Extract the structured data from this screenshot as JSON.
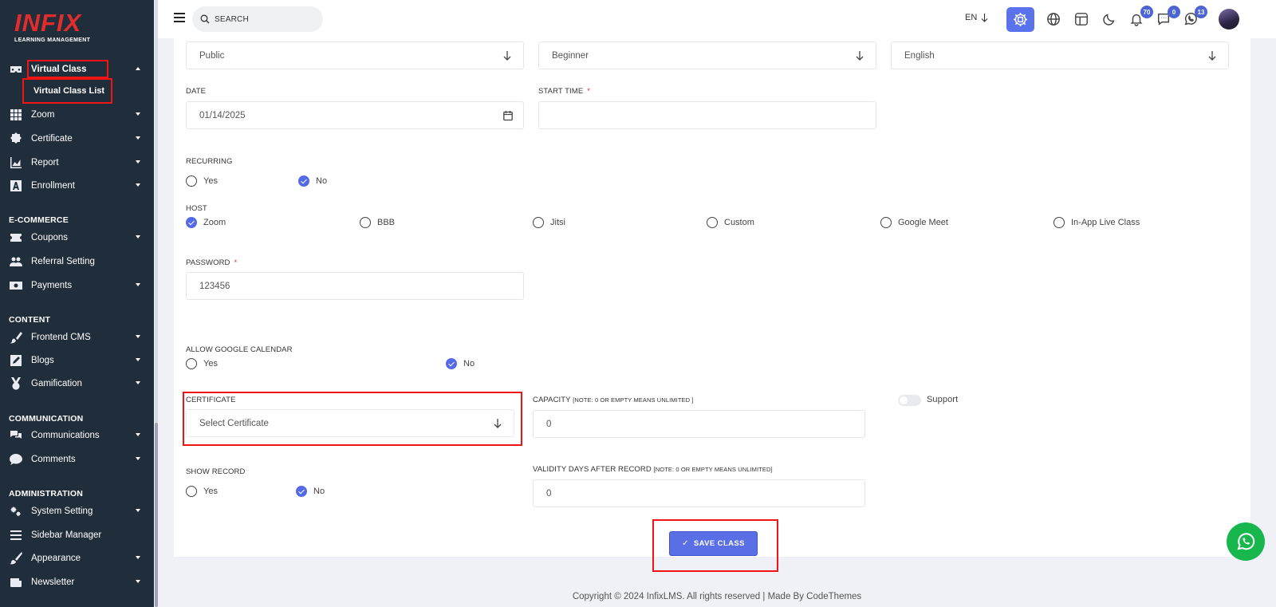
{
  "app": {
    "logo_text": "INFIX",
    "logo_subtitle": "LEARNING MANAGEMENT"
  },
  "sidebar": {
    "active_parent": "Virtual Class",
    "active_sub": "Virtual Class List",
    "items": [
      {
        "label": "Zoom",
        "icon": "grid-icon"
      },
      {
        "label": "Certificate",
        "icon": "badge-icon"
      },
      {
        "label": "Report",
        "icon": "chart-icon"
      },
      {
        "label": "Enrollment",
        "icon": "enrollment-icon"
      },
      {
        "label": "Coupons",
        "icon": "ticket-icon"
      },
      {
        "label": "Referral Setting",
        "icon": "users-icon"
      },
      {
        "label": "Payments",
        "icon": "money-icon"
      },
      {
        "label": "Frontend CMS",
        "icon": "brush-icon"
      },
      {
        "label": "Blogs",
        "icon": "pen-icon"
      },
      {
        "label": "Gamification",
        "icon": "medal-icon"
      },
      {
        "label": "Communications",
        "icon": "chat-icon"
      },
      {
        "label": "Comments",
        "icon": "comment-icon"
      },
      {
        "label": "System Setting",
        "icon": "gears-icon"
      },
      {
        "label": "Sidebar Manager",
        "icon": "list-icon"
      },
      {
        "label": "Appearance",
        "icon": "paint-icon"
      },
      {
        "label": "Newsletter",
        "icon": "newsletter-icon"
      }
    ],
    "sections": {
      "ecommerce": "E-COMMERCE",
      "content": "CONTENT",
      "communication": "COMMUNICATION",
      "administration": "ADMINISTRATION"
    }
  },
  "header": {
    "search_placeholder": "SEARCH",
    "language": "EN",
    "notifications_count": "70",
    "messages_count": "0",
    "whatsapp_count": "13"
  },
  "form": {
    "access_value": "Public",
    "level_value": "Beginner",
    "language_value": "English",
    "date_label": "DATE",
    "date_value": "01/14/2025",
    "start_time_label": "START TIME",
    "start_time_value": "",
    "required_mark": "*",
    "recurring_label": "RECURRING",
    "yes": "Yes",
    "no": "No",
    "host_label": "HOST",
    "hosts": [
      "Zoom",
      "BBB",
      "Jitsi",
      "Custom",
      "Google Meet",
      "In-App Live Class"
    ],
    "selected_host": "Zoom",
    "password_label": "PASSWORD",
    "password_value": "123456",
    "google_calendar_label": "ALLOW GOOGLE CALENDAR",
    "certificate_label": "CERTIFICATE",
    "certificate_placeholder": "Select Certificate",
    "capacity_label": "CAPACITY",
    "capacity_note": "[NOTE: 0 OR EMPTY MEANS UNLIMITED ]",
    "capacity_value": "0",
    "support_label": "Support",
    "support_enabled": false,
    "show_record_label": "SHOW RECORD",
    "validity_label": "VALIDITY DAYS AFTER RECORD",
    "validity_note": "[NOTE: 0 OR EMPTY MEANS UNLIMITED]",
    "validity_value": "0",
    "recurring_selected": "No",
    "google_calendar_selected": "No",
    "show_record_selected": "No",
    "save_label": "SAVE CLASS"
  },
  "footer": {
    "copyright": "Copyright © 2024 InfixLMS. All rights reserved | Made By CodeThemes"
  },
  "colors": {
    "sidebar_bg": "#202e3b",
    "accent": "#5a6fe6",
    "highlight": "#f01414",
    "whatsapp": "#18b74d"
  }
}
